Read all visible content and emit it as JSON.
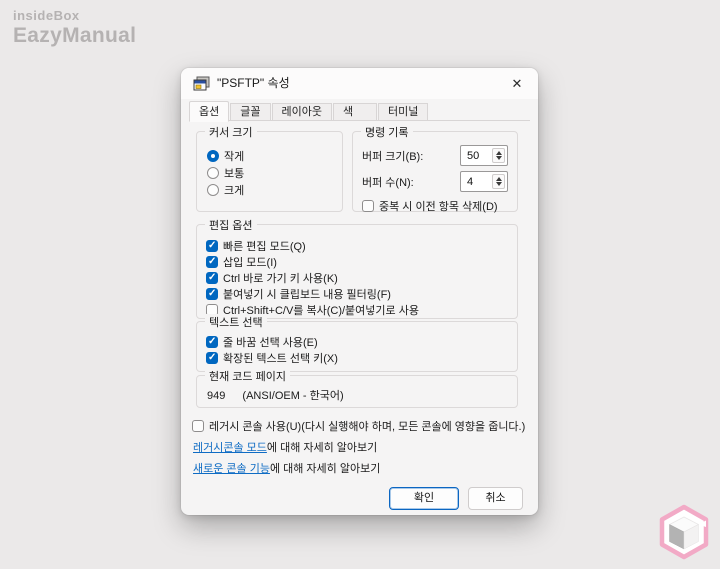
{
  "page": {
    "logo": {
      "line1": "insideBox",
      "line2": "EazyManual"
    }
  },
  "icons": {
    "close": "✕"
  },
  "dialog": {
    "title": "\"PSFTP\" 속성",
    "tabs": [
      {
        "label": "옵션",
        "selected": true
      },
      {
        "label": "글꼴",
        "selected": false
      },
      {
        "label": "레이아웃",
        "selected": false
      },
      {
        "label": "색",
        "selected": false
      },
      {
        "label": "터미널",
        "selected": false
      }
    ],
    "cursor_size": {
      "legend": "커서 크기",
      "options": [
        {
          "label": "작게",
          "selected": true
        },
        {
          "label": "보통",
          "selected": false
        },
        {
          "label": "크게",
          "selected": false
        }
      ]
    },
    "command_history": {
      "legend": "명령 기록",
      "buffer_size_label": "버퍼 크기(B):",
      "buffer_size_value": "50",
      "buffer_count_label": "버퍼 수(N):",
      "buffer_count_value": "4",
      "discard_duplicates": {
        "label": "중복 시 이전 항목 삭제(D)",
        "checked": false
      }
    },
    "edit_options": {
      "legend": "편집 옵션",
      "items": [
        {
          "label": "빠른 편집 모드(Q)",
          "checked": true
        },
        {
          "label": "삽입 모드(I)",
          "checked": true
        },
        {
          "label": "Ctrl 바로 가기 키 사용(K)",
          "checked": true
        },
        {
          "label": "붙여넣기 시 클립보드 내용 필터링(F)",
          "checked": true
        },
        {
          "label": "Ctrl+Shift+C/V를 복사(C)/붙여넣기로 사용",
          "checked": false
        }
      ]
    },
    "text_selection": {
      "legend": "텍스트 선택",
      "items": [
        {
          "label": "줄 바꿈 선택 사용(E)",
          "checked": true
        },
        {
          "label": "확장된 텍스트 선택 키(X)",
          "checked": true
        }
      ]
    },
    "code_page": {
      "legend": "현재 코드 페이지",
      "code": "949",
      "name": "(ANSI/OEM - 한국어)"
    },
    "legacy": {
      "label": "레거시 콘솔 사용(U)(다시 실행해야 하며, 모든 콘솔에 영향을 줍니다.)",
      "checked": false
    },
    "links": [
      {
        "link_text": "레거시콘솔 모드",
        "suffix": "에 대해 자세히 알아보기"
      },
      {
        "link_text": "새로운 콘솔 기능",
        "suffix": "에 대해 자세히 알아보기"
      }
    ],
    "buttons": {
      "ok": "확인",
      "cancel": "취소"
    }
  },
  "colors": {
    "accent": "#0067c0",
    "link": "#0f6cc4",
    "logo_gray": "#b5b2b2",
    "watermark_pink": "#f2aac6",
    "dialog_bg": "#f5f4f4"
  }
}
